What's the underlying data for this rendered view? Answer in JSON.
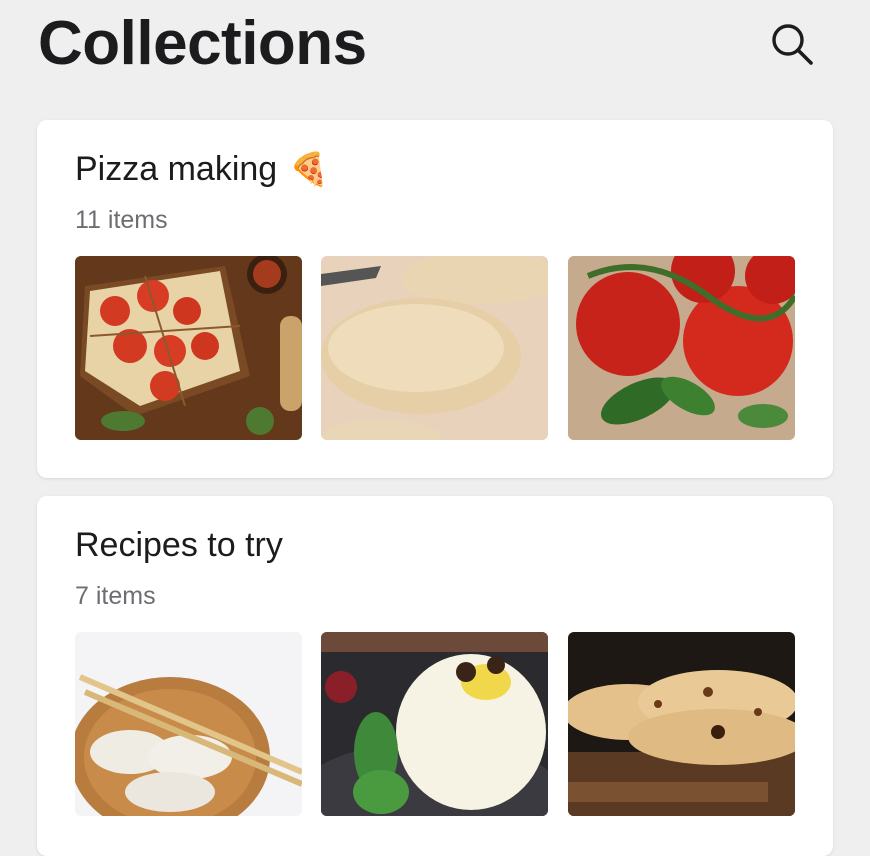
{
  "header": {
    "title": "Collections",
    "search_icon": "search-icon"
  },
  "collections": [
    {
      "title": "Pizza making",
      "emoji": "🍕",
      "count": "11 items",
      "thumbnails": [
        "pizza-slices-image",
        "pizza-dough-image",
        "tomatoes-basil-image"
      ]
    },
    {
      "title": "Recipes to try",
      "count": "7 items",
      "thumbnails": [
        "dumplings-image",
        "dessert-mint-image",
        "flatbread-image"
      ]
    }
  ],
  "colors": {
    "background": "#efefef",
    "card": "#ffffff",
    "secondary_text": "#6d6d72"
  }
}
